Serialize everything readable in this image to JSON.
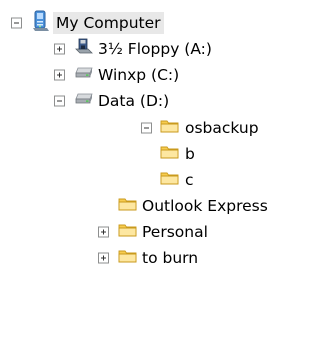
{
  "tree": [
    {
      "label": "My Computer",
      "expanded": true,
      "icon": "computer-icon",
      "selected": true
    },
    {
      "label": "3½ Floppy (A:)",
      "expanded": false,
      "icon": "floppy-drive-icon"
    },
    {
      "label": "Winxp (C:)",
      "expanded": false,
      "icon": "hard-drive-icon"
    },
    {
      "label": "Data (D:)",
      "expanded": true,
      "icon": "hard-drive-icon"
    },
    {
      "label": "osbackup",
      "expanded": true,
      "icon": "folder-icon"
    },
    {
      "label": "b",
      "icon": "folder-icon"
    },
    {
      "label": "c",
      "icon": "folder-icon"
    },
    {
      "label": "Outlook Express",
      "icon": "folder-icon"
    },
    {
      "label": "Personal",
      "expanded": false,
      "icon": "folder-icon"
    },
    {
      "label": "to burn",
      "expanded": false,
      "icon": "folder-icon"
    }
  ]
}
